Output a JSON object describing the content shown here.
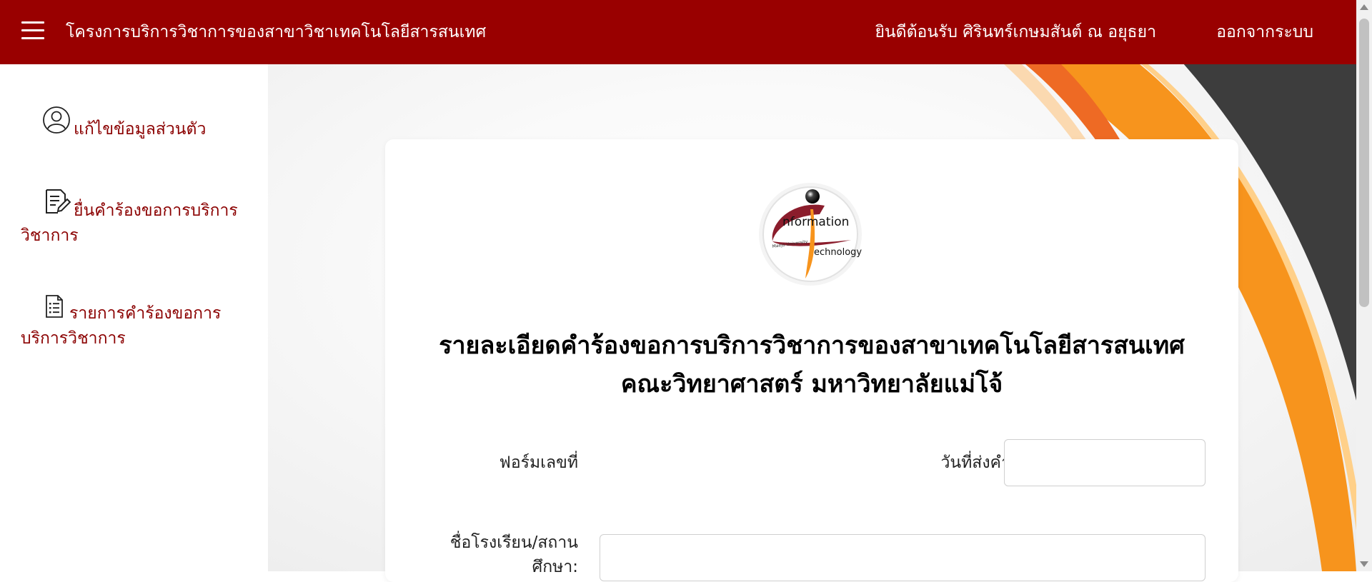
{
  "header": {
    "site_title": "โครงการบริการวิชาการของสาขาวิชาเทคโนโลยีสารสนเทศ",
    "welcome": "ยินดีต้อนรับ ศิรินทร์เกษมสันต์ ณ อยุธยา",
    "logout_label": "ออกจากระบบ",
    "menu_icon": "hamburger-menu-icon",
    "bg_color": "#990000"
  },
  "sidebar": {
    "items": [
      {
        "icon": "user-circle-icon",
        "label_line1": "แก้ไขข้อมูลส่วนตัว",
        "label_line2": ""
      },
      {
        "icon": "edit-document-icon",
        "label_line1": "ยื่นคำร้องขอการบริการ",
        "label_line2": "วิชาการ"
      },
      {
        "icon": "list-document-icon",
        "label_line1": "รายการคำร้องขอการ",
        "label_line2": "บริการวิชาการ"
      }
    ],
    "text_color": "#8b0000"
  },
  "card": {
    "logo_text_1": "nformation",
    "logo_text_2": "echnology",
    "logo_text_3": "Maejo University",
    "title_line1": "รายละเอียดคำร้องขอการบริการวิชาการของสาขาเทคโนโลยีสารสนเทศ",
    "title_line2": "คณะวิทยาศาสตร์ มหาวิทยาลัยแม่โจ้",
    "form_no_label": "ฟอร์มเลขที่",
    "form_no_value": "",
    "submit_date_label": "วันที่ส่งคำร้อง:",
    "submit_date_value": "",
    "school_label_line1": "ชื่อโรงเรียน/สถาน",
    "school_label_line2": "ศึกษา:",
    "school_value": ""
  },
  "colors": {
    "accent_orange": "#f7941d",
    "dark_arc": "#3a3a3a"
  }
}
